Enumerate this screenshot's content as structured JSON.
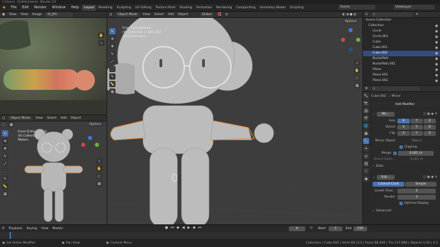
{
  "title_bar": {
    "text": "C:\\Users\\...\\Untitled.blend - Blender 3.6"
  },
  "menu": {
    "logo": "◆",
    "items": [
      "File",
      "Edit",
      "Render",
      "Window",
      "Help"
    ]
  },
  "workspaces": [
    "Layout",
    "Modeling",
    "Sculpting",
    "UV Editing",
    "Texture Paint",
    "Shading",
    "Animation",
    "Rendering",
    "Compositing",
    "Geometry Nodes",
    "Scripting"
  ],
  "active_workspace": "Layout",
  "top_right": {
    "scene": "Scene",
    "view_layer": "ViewLayer"
  },
  "image_editor": {
    "menus": [
      "View",
      "View",
      "Image"
    ],
    "image_name": "df_JPG"
  },
  "small_viewport": {
    "mode": "Object Mode",
    "menus": [
      "View",
      "Select",
      "Add",
      "Object"
    ],
    "options": "Options",
    "overlay": {
      "line1": "Front Orthographic",
      "line2": "(0) Collection | Cube.002",
      "line3": "Meters"
    }
  },
  "main_viewport": {
    "mode": "Object Mode",
    "menus": [
      "View",
      "Select",
      "Add",
      "Object"
    ],
    "transform": "Global",
    "options": "Options",
    "overlay": {
      "line1": "Front Orthographic",
      "line2": "(0) Collection | Cube.002",
      "line3": "10 Centimeters"
    }
  },
  "outliner": {
    "root": "Scene Collection",
    "collection": "Collection",
    "items": [
      "Circle",
      "Circle.001",
      "Cube",
      "Cube.001",
      "Cube.002",
      "NurbsPath",
      "NurbsPath.001",
      "Plane",
      "Plane.001",
      "Plane.002"
    ],
    "selected": "Cube.002"
  },
  "properties": {
    "object": "Cube.002",
    "modifier_type": "Mirror",
    "add_modifier": "Add Modifier",
    "mirror": {
      "name": "Mir...",
      "axis_label": "Axis",
      "bisect_label": "Bisect",
      "flip_label": "Flip",
      "axes": [
        "X",
        "Y",
        "Z"
      ],
      "mirror_object_label": "Mirror Object",
      "mirror_object_placeholder": "Object",
      "clipping": "Clipping",
      "merge_label": "Merge",
      "merge_value": "0.001 m",
      "bisect_dist_label": "Bisect Dista...",
      "bisect_dist_value": "0.001 m",
      "data": "Data"
    },
    "subsurf": {
      "name": "Sub...",
      "tab_cc": "Catmull-Clark",
      "tab_simple": "Simple",
      "levels_label": "Levels View...",
      "levels_value": "2",
      "render_label": "Render",
      "render_value": "3",
      "optimal": "Optimal Display",
      "advanced": "Advanced"
    }
  },
  "timeline": {
    "menus": [
      "Playback",
      "Keying",
      "View",
      "Marker"
    ],
    "current_frame": "0",
    "start_label": "Start",
    "start": "1",
    "end_label": "End",
    "end": "250"
  },
  "status_bar": {
    "left1": "Set Active Modifier",
    "left2": "Pan View",
    "left3": "Context Menu",
    "right": "Collection | Cube.002 | Verts:69,113 | Faces:68,496 | Tris:137,888 | Objects:1/16 | 4.1"
  },
  "colors": {
    "accent": "#4772b3",
    "selection_outline": "#e8892a",
    "model": "#b9b9b9",
    "viewport_bg": "#3d3d3d"
  }
}
